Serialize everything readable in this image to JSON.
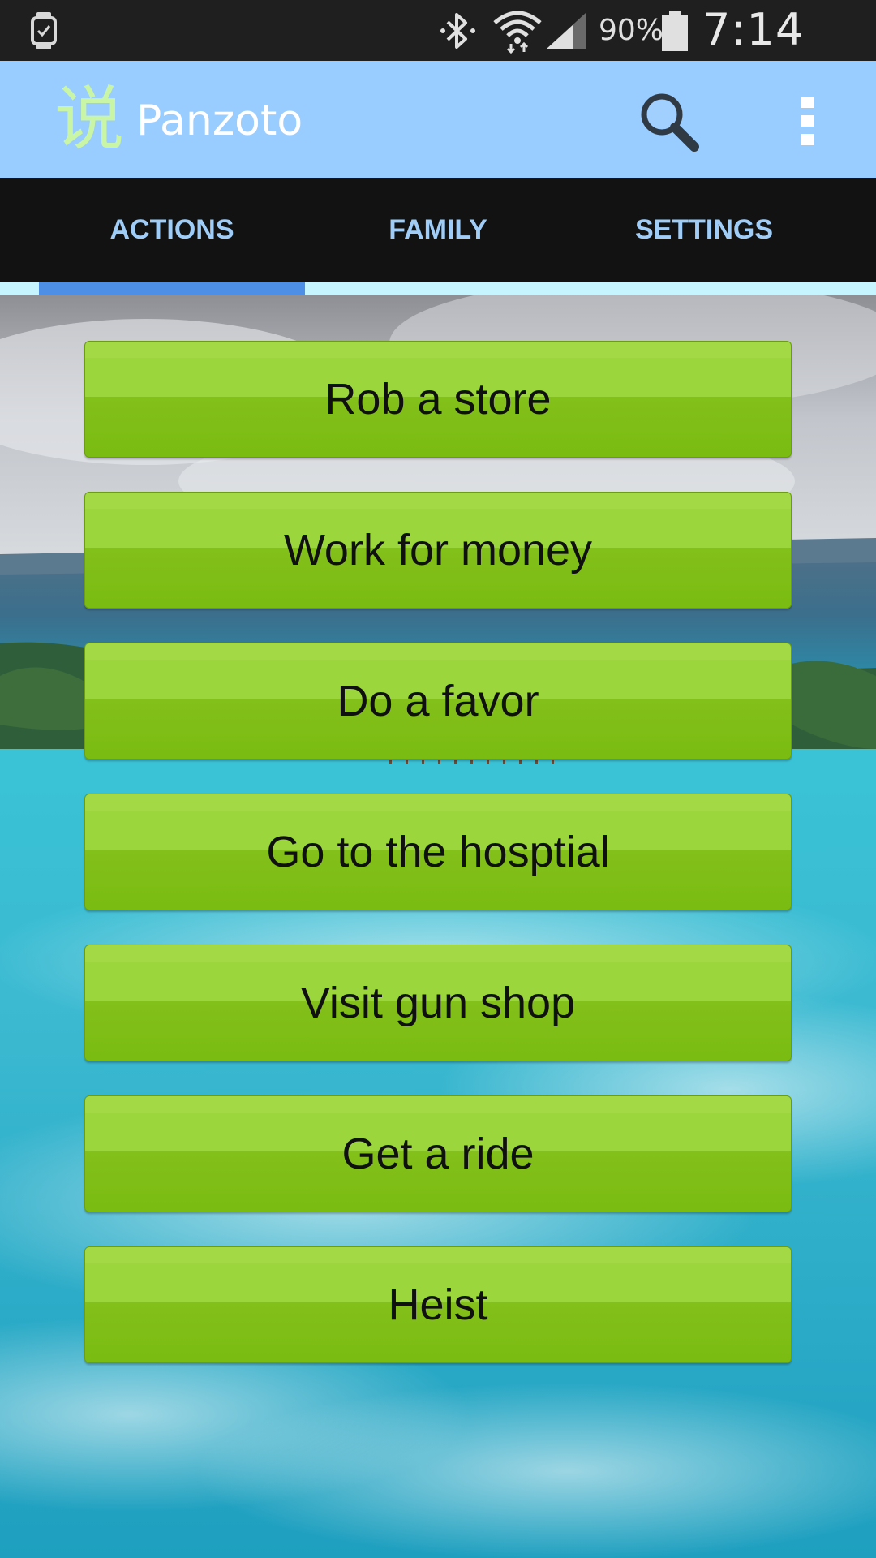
{
  "status_bar": {
    "battery_percent": "90%",
    "time": "7:14 PM",
    "icons": [
      "smartwatch-icon",
      "bluetooth-icon",
      "wifi-icon",
      "signal-icon",
      "battery-icon"
    ]
  },
  "app_bar": {
    "title": "Panzoto",
    "logo_glyph": "说",
    "background_color": "#99ccff",
    "actions": [
      "search-icon",
      "overflow-menu-icon"
    ]
  },
  "tabs": {
    "items": [
      {
        "label": "ACTIONS",
        "selected": true
      },
      {
        "label": "FAMILY",
        "selected": false
      },
      {
        "label": "SETTINGS",
        "selected": false
      }
    ],
    "indicator_color": "#4d8fe6"
  },
  "actions": {
    "buttons": [
      {
        "label": "Rob a store"
      },
      {
        "label": "Work for money"
      },
      {
        "label": "Do a favor"
      },
      {
        "label": "Go to the hosptial"
      },
      {
        "label": "Visit gun shop"
      },
      {
        "label": "Get a ride"
      },
      {
        "label": "Heist"
      }
    ],
    "button_color": "#8dc92a"
  }
}
